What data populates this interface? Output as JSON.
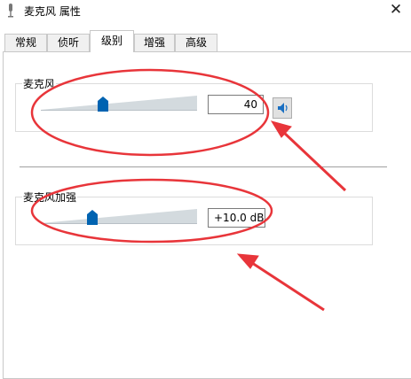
{
  "window": {
    "title": "麦克风 属性",
    "title_icon": "microphone-icon",
    "close_glyph": "✕"
  },
  "tabs": [
    {
      "label": "常规",
      "active": false
    },
    {
      "label": "侦听",
      "active": false
    },
    {
      "label": "级别",
      "active": true
    },
    {
      "label": "增强",
      "active": false
    },
    {
      "label": "高级",
      "active": false
    }
  ],
  "microphone": {
    "label": "麦克风",
    "value": "40",
    "level_fraction": 0.4,
    "speaker_icon": "speaker-icon"
  },
  "boost": {
    "label": "麦克风加强",
    "value": "+10.0 dB",
    "level_fraction": 0.33
  },
  "annotations": {
    "color": "#e8353a"
  },
  "colors": {
    "accent": "#0063b1",
    "ramp": "#d0d7de"
  }
}
